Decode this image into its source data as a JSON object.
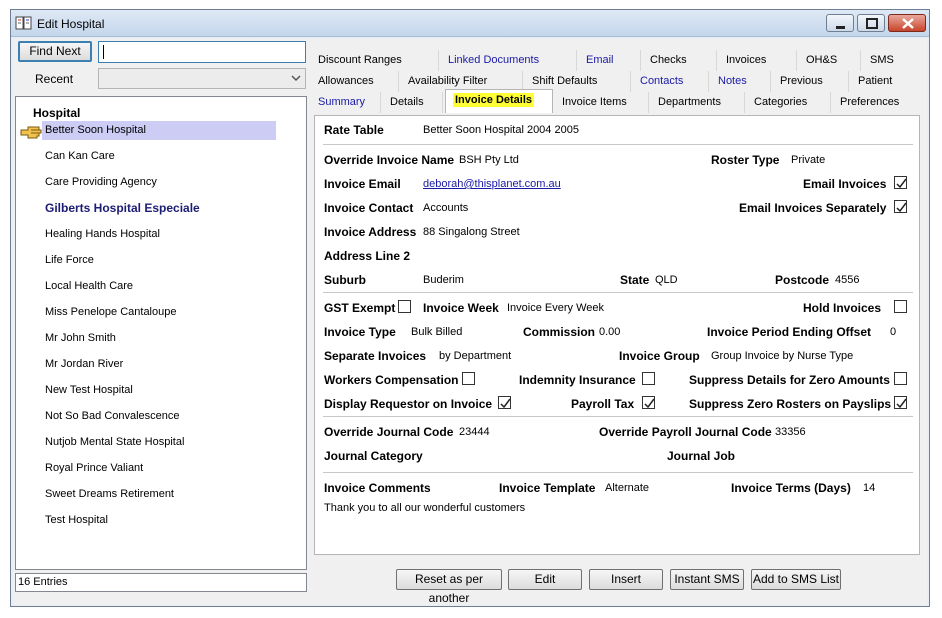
{
  "window": {
    "title": "Edit Hospital"
  },
  "search": {
    "find_next_label": "Find Next",
    "value": "",
    "recent_label": "Recent",
    "recent_value": ""
  },
  "list": {
    "header": "Hospital",
    "items": [
      "Better Soon Hospital",
      "Can Kan Care",
      "Care Providing Agency",
      "Gilberts Hospital Especiale",
      "Healing Hands Hospital",
      "Life Force",
      "Local Health Care",
      "Miss Penelope Cantaloupe",
      "Mr John Smith",
      "Mr Jordan River",
      "New Test Hospital",
      "Not So Bad Convalescence",
      "Nutjob Mental State Hospital",
      "Royal Prince Valiant",
      "Sweet Dreams Retirement",
      "Test Hospital"
    ],
    "selected": "Better Soon Hospital",
    "status": "16 Entries"
  },
  "tabs": {
    "row1": [
      "Discount Ranges",
      "Linked Documents",
      "Email",
      "Checks",
      "Invoices",
      "OH&S",
      "SMS"
    ],
    "row2": [
      "Allowances",
      "Availability Filter",
      "Shift Defaults",
      "Contacts",
      "Notes",
      "Previous",
      "Patient"
    ],
    "row3": [
      "Summary",
      "Details",
      "Invoice Details",
      "Invoice Items",
      "Departments",
      "Categories",
      "Preferences"
    ],
    "active": "Invoice Details"
  },
  "form": {
    "rate_table_label": "Rate Table",
    "rate_table": "Better Soon Hospital 2004 2005",
    "override_invoice_name_label": "Override Invoice Name",
    "override_invoice_name": "BSH Pty Ltd",
    "roster_type_label": "Roster Type",
    "roster_type": "Private",
    "invoice_email_label": "Invoice Email",
    "invoice_email": "deborah@thisplanet.com.au",
    "email_invoices_label": "Email Invoices",
    "email_invoices": true,
    "invoice_contact_label": "Invoice Contact",
    "invoice_contact": "Accounts",
    "email_separately_label": "Email Invoices Separately",
    "email_separately": true,
    "invoice_address_label": "Invoice Address",
    "invoice_address": "88 Singalong Street",
    "address_line2_label": "Address Line 2",
    "suburb_label": "Suburb",
    "suburb": "Buderim",
    "state_label": "State",
    "state": "QLD",
    "postcode_label": "Postcode",
    "postcode": "4556",
    "gst_exempt_label": "GST Exempt",
    "gst_exempt": false,
    "invoice_week_label": "Invoice Week",
    "invoice_week": "Invoice Every Week",
    "hold_invoices_label": "Hold Invoices",
    "hold_invoices": false,
    "invoice_type_label": "Invoice Type",
    "invoice_type": "Bulk Billed",
    "commission_label": "Commission",
    "commission": "0.00",
    "period_offset_label": "Invoice Period Ending Offset",
    "period_offset": "0",
    "separate_invoices_label": "Separate Invoices",
    "separate_invoices": "by Department",
    "invoice_group_label": "Invoice Group",
    "invoice_group": "Group Invoice by Nurse Type",
    "workers_comp_label": "Workers Compensation",
    "workers_comp": false,
    "indemnity_label": "Indemnity Insurance",
    "indemnity": false,
    "suppress_details_label": "Suppress Details for Zero Amounts",
    "suppress_details": false,
    "display_requestor_label": "Display Requestor on Invoice",
    "display_requestor": true,
    "payroll_tax_label": "Payroll Tax",
    "payroll_tax": true,
    "suppress_rosters_label": "Suppress Zero Rosters on Payslips",
    "suppress_rosters": true,
    "journal_code_label": "Override Journal Code",
    "journal_code": "23444",
    "payroll_journal_label": "Override Payroll Journal Code",
    "payroll_journal": "33356",
    "journal_category_label": "Journal Category",
    "journal_job_label": "Journal Job",
    "comments_label": "Invoice Comments",
    "invoice_template_label": "Invoice Template",
    "invoice_template": "Alternate",
    "invoice_terms_label": "Invoice Terms (Days)",
    "invoice_terms": "14",
    "comments": "Thank you to all our wonderful customers"
  },
  "buttons": {
    "reset": "Reset as per another",
    "edit": "Edit",
    "insert": "Insert",
    "instant_sms": "Instant SMS",
    "add_sms": "Add to SMS List"
  },
  "colors": {
    "selection": "#ccccf5",
    "tab_highlight": "#ffff33",
    "link": "#1a1aa6"
  }
}
